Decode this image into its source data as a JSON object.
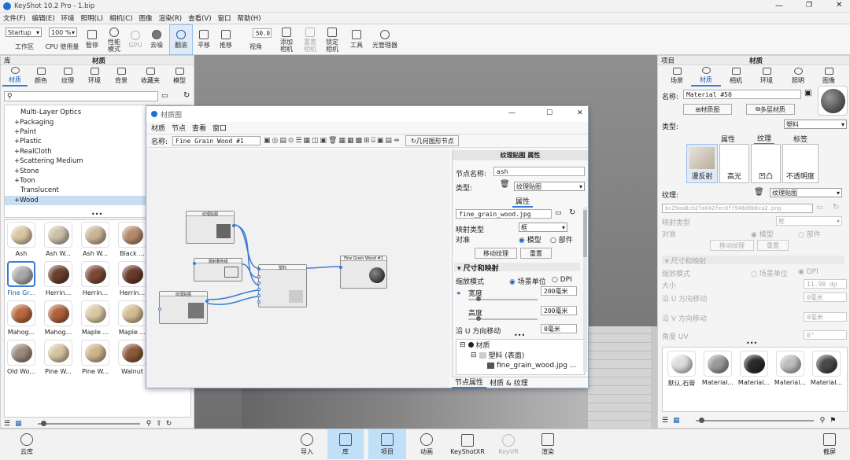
{
  "window": {
    "title": "KeyShot 10.2 Pro - 1.bip"
  },
  "menu": [
    "文件(F)",
    "编辑(E)",
    "环境",
    "照明(L)",
    "相机(C)",
    "图像",
    "渲染(R)",
    "查看(V)",
    "窗口",
    "帮助(H)"
  ],
  "toolbar": {
    "workspace_select": "Startup",
    "zoom_select": "100 %",
    "fov_value": "50.0",
    "items": [
      {
        "label": "工作区"
      },
      {
        "label": "CPU 使用量"
      },
      {
        "label": "暂停"
      },
      {
        "label": "性能\n模式"
      },
      {
        "label": "GPU"
      },
      {
        "label": "去噪"
      },
      {
        "label": "翻滚"
      },
      {
        "label": "平移"
      },
      {
        "label": "推移"
      },
      {
        "label": "视角"
      },
      {
        "label": "添加\n相机"
      },
      {
        "label": "重置\n相机"
      },
      {
        "label": "锁定\n相机"
      },
      {
        "label": "工具"
      },
      {
        "label": "光管理器"
      }
    ]
  },
  "library": {
    "title": "库",
    "header": "材质",
    "tabs": [
      "材质",
      "颜色",
      "纹理",
      "环境",
      "背景",
      "收藏夹",
      "模型"
    ],
    "tree": [
      "Multi-Layer Optics",
      "Packaging",
      "Paint",
      "Plastic",
      "RealCloth",
      "Scattering Medium",
      "Stone",
      "Toon",
      "Translucent",
      "Wood"
    ],
    "thumbs": [
      {
        "label": "Ash",
        "color": "#d9c6a2"
      },
      {
        "label": "Ash W...",
        "color": "#cbbfa9"
      },
      {
        "label": "Ash W...",
        "color": "#c8b597"
      },
      {
        "label": "Black ...",
        "color": "#b58a6a"
      },
      {
        "label": "Black ...",
        "color": "#a87a58"
      },
      {
        "label": "Fine Gr...",
        "color": "#a9a9a9"
      },
      {
        "label": "Herrin...",
        "color": "#6b3e2e"
      },
      {
        "label": "Herrin...",
        "color": "#7a4a36"
      },
      {
        "label": "Herrin...",
        "color": "#6a3a2a"
      },
      {
        "label": "Herrin...",
        "color": "#8a5a3a"
      },
      {
        "label": "Mahog...",
        "color": "#b8683e"
      },
      {
        "label": "Mahog...",
        "color": "#b0603a"
      },
      {
        "label": "Maple ...",
        "color": "#dbc7a3"
      },
      {
        "label": "Maple ...",
        "color": "#d4bc90"
      },
      {
        "label": "Oak W...",
        "color": "#c9a35a"
      },
      {
        "label": "Old Wo...",
        "color": "#9a8a7a"
      },
      {
        "label": "Pine W...",
        "color": "#d6c4a0"
      },
      {
        "label": "Pine W...",
        "color": "#cdb48a"
      },
      {
        "label": "Walnut",
        "color": "#8a5a3a"
      },
      {
        "label": "Wood",
        "color": "#a07050"
      }
    ]
  },
  "material_graph": {
    "title": "材质图",
    "menu": [
      "材质",
      "节点",
      "查看",
      "窗口"
    ],
    "name_label": "名称:",
    "name_value": "Fine Grain Wood #1",
    "geo_button": "几何图形节点",
    "nodes": [
      {
        "title": "纹理贴图"
      },
      {
        "title": "漫射着色组"
      },
      {
        "title": "纹理贴图"
      },
      {
        "title": "塑料"
      },
      {
        "title": "Fine Grain Wood #1"
      }
    ],
    "props": {
      "header": "纹理贴图 属性",
      "node_name_label": "节点名称:",
      "node_name_value": "ash",
      "type_label": "类型:",
      "type_value": "纹理贴图",
      "attr_tab": "属性",
      "file": "fine_grain_wood.jpg",
      "mapping_label": "映射类型",
      "mapping_value": "框",
      "align_label": "对准",
      "align_opt1": "模型",
      "align_opt2": "部件",
      "move_tex": "移动纹理",
      "reset": "重置",
      "section": "尺寸和映射",
      "scale_mode_label": "缩放模式",
      "scale_opt1": "场景单位",
      "scale_opt2": "DPI",
      "width_label": "宽度",
      "width_value": "200毫米",
      "height_label": "高度",
      "height_value": "200毫米",
      "u_label": "沿 U 方向移动",
      "u_value": "0毫米",
      "tree": [
        "材质",
        "塑料 (表面)",
        "fine_grain_wood.jpg ..."
      ],
      "bottom_tabs": [
        "节点属性",
        "材质 & 纹理"
      ]
    }
  },
  "project": {
    "title": "项目",
    "header": "材质",
    "tabs": [
      "场景",
      "材质",
      "相机",
      "环境",
      "照明",
      "图像"
    ],
    "name_label": "名称:",
    "name_value": "Material #50",
    "graph_button": "材质图",
    "multi_button": "多层材质",
    "type_label": "类型:",
    "type_value": "塑料",
    "subtabs": [
      "属性",
      "纹理",
      "标签"
    ],
    "slots": [
      "漫反射",
      "高光",
      "凹凸",
      "不透明度"
    ],
    "texture_label": "纹理:",
    "texture_type": "纹理贴图",
    "file": "bc29aa8cb2fe042fec0ff948d9b8ca2.png",
    "mapping_label": "映射类型",
    "mapping_value": "框",
    "align_label": "对准",
    "align_opt1": "模型",
    "align_opt2": "部件",
    "move_tex": "移动纹理",
    "reset": "重置",
    "section": "尺寸和映射",
    "scale_label": "缩放模式",
    "scale_opt1": "场景单位",
    "scale_opt2": "DPI",
    "size_label": "大小",
    "size_value": "11.90 dp",
    "u_label": "沿 U 方向移动",
    "u_value": "0毫米",
    "v_label": "沿 V 方向移动",
    "v_value": "0毫米",
    "angle_label": "角度 UV",
    "angle_value": "0°",
    "thumbs": [
      {
        "label": "默认,石膏",
        "color": "#dcdcdc"
      },
      {
        "label": "Material...",
        "color": "#9a9a9a"
      },
      {
        "label": "Material...",
        "color": "#2a2a2a"
      },
      {
        "label": "Material...",
        "color": "#bdbdbd"
      },
      {
        "label": "Material...",
        "color": "#4a4a4a"
      }
    ]
  },
  "bottom": {
    "left": "云库",
    "items": [
      "导入",
      "库",
      "项目",
      "动画",
      "KeyShotXR",
      "KeyVR",
      "渲染"
    ],
    "right": "截屏"
  }
}
